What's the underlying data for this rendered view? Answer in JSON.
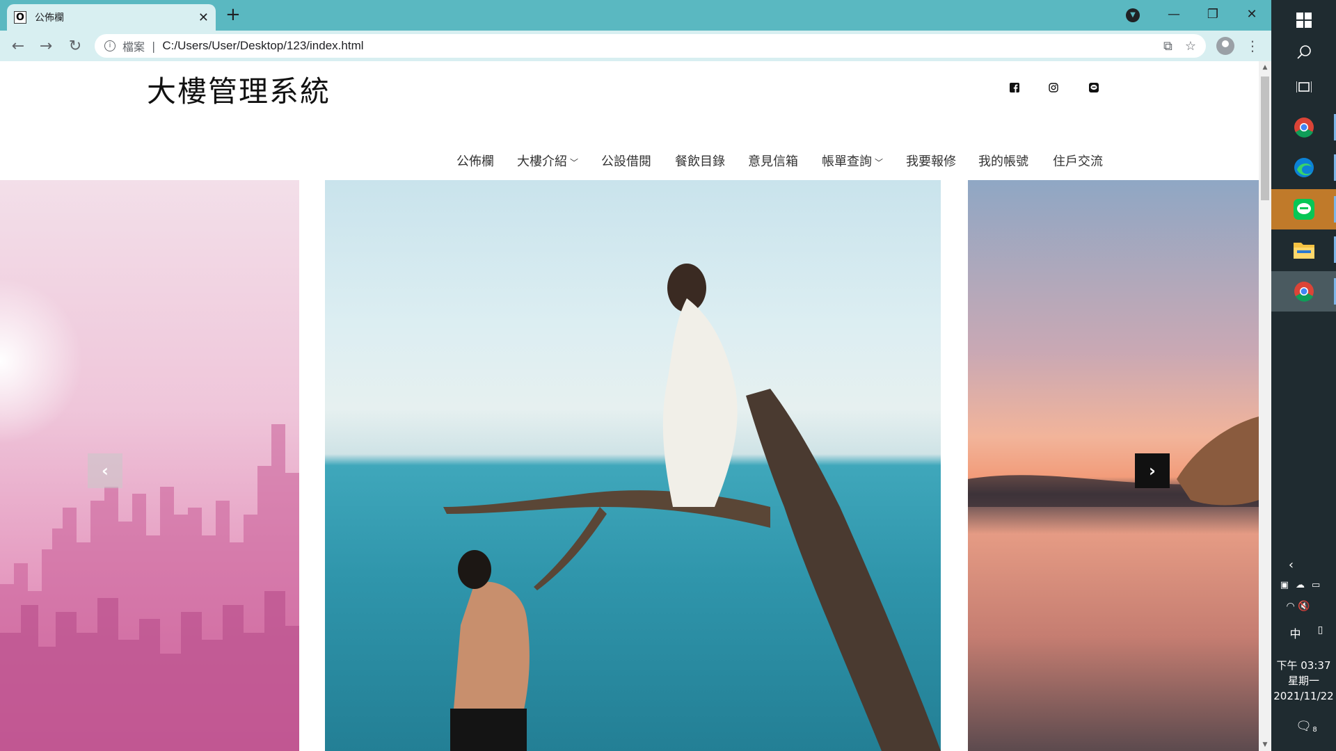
{
  "browser": {
    "tab_title": "公佈欄",
    "tab_favicon": "O",
    "url_scheme_label": "檔案",
    "url": "C:/Users/User/Desktop/123/index.html"
  },
  "site": {
    "logo": "大樓管理系統",
    "social_icons": [
      "facebook-icon",
      "instagram-icon",
      "line-icon"
    ],
    "menu": [
      {
        "label": "公佈欄",
        "has_dropdown": false
      },
      {
        "label": "大樓介紹",
        "has_dropdown": true
      },
      {
        "label": "公設借閱",
        "has_dropdown": false
      },
      {
        "label": "餐飲目錄",
        "has_dropdown": false
      },
      {
        "label": "意見信箱",
        "has_dropdown": false
      },
      {
        "label": "帳單查詢",
        "has_dropdown": true
      },
      {
        "label": "我要報修",
        "has_dropdown": false
      },
      {
        "label": "我的帳號",
        "has_dropdown": false
      },
      {
        "label": "住戶交流",
        "has_dropdown": false
      }
    ]
  },
  "taskbar": {
    "ime": "中",
    "time": "下午 03:37",
    "weekday": "星期一",
    "date": "2021/11/22",
    "notifications": "8"
  }
}
